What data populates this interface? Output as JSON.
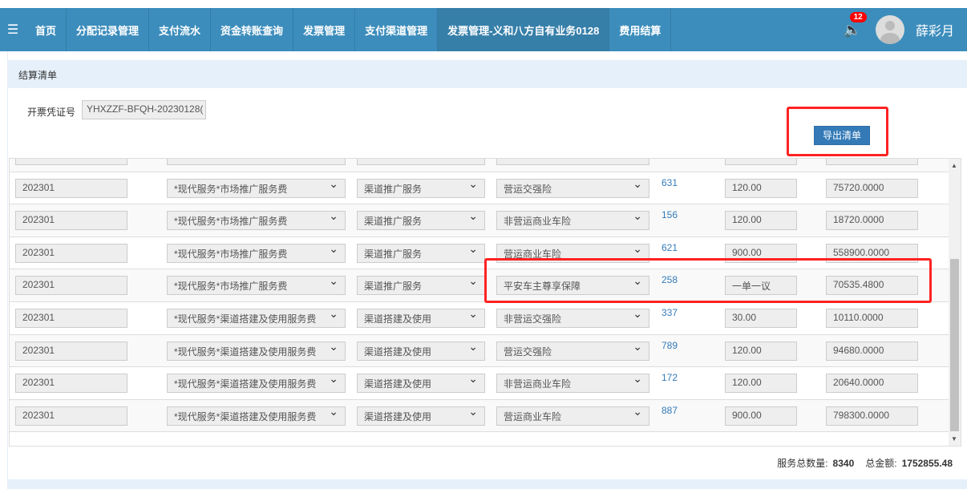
{
  "nav": {
    "items": [
      "首页",
      "分配记录管理",
      "支付流水",
      "资金转账查询",
      "发票管理",
      "支付渠道管理",
      "发票管理-义和八方自有业务0128",
      "费用结算"
    ],
    "active": 6
  },
  "notifications": {
    "count": "12"
  },
  "user": {
    "name": "薛彩月"
  },
  "panel": {
    "title": "结算清单",
    "voucher_label": "开票凭证号",
    "voucher_value": "YHXZZF-BFQH-20230128(",
    "export_label": "导出清单"
  },
  "rows": [
    {
      "period": "202301",
      "service": "*现代服务*市场推广服务费",
      "channel": "渠道推广服务",
      "product": "营运交强险",
      "count": "631",
      "price": "120.00",
      "amount": "75720.0000"
    },
    {
      "period": "202301",
      "service": "*现代服务*市场推广服务费",
      "channel": "渠道推广服务",
      "product": "非营运商业车险",
      "count": "156",
      "price": "120.00",
      "amount": "18720.0000"
    },
    {
      "period": "202301",
      "service": "*现代服务*市场推广服务费",
      "channel": "渠道推广服务",
      "product": "营运商业车险",
      "count": "621",
      "price": "900.00",
      "amount": "558900.0000"
    },
    {
      "period": "202301",
      "service": "*现代服务*市场推广服务费",
      "channel": "渠道推广服务",
      "product": "平安车主尊享保障",
      "count": "258",
      "price": "一单一议",
      "amount": "70535.4800"
    },
    {
      "period": "202301",
      "service": "*现代服务*渠道搭建及使用服务费",
      "channel": "渠道搭建及使用",
      "product": "非营运交强险",
      "count": "337",
      "price": "30.00",
      "amount": "10110.0000"
    },
    {
      "period": "202301",
      "service": "*现代服务*渠道搭建及使用服务费",
      "channel": "渠道搭建及使用",
      "product": "营运交强险",
      "count": "789",
      "price": "120.00",
      "amount": "94680.0000"
    },
    {
      "period": "202301",
      "service": "*现代服务*渠道搭建及使用服务费",
      "channel": "渠道搭建及使用",
      "product": "非营运商业车险",
      "count": "172",
      "price": "120.00",
      "amount": "20640.0000"
    },
    {
      "period": "202301",
      "service": "*现代服务*渠道搭建及使用服务费",
      "channel": "渠道搭建及使用",
      "product": "营运商业车险",
      "count": "887",
      "price": "900.00",
      "amount": "798300.0000"
    }
  ],
  "summary": {
    "count_label": "服务总数量:",
    "count_value": "8340",
    "amount_label": "总金额:",
    "amount_value": "1752855.48"
  }
}
